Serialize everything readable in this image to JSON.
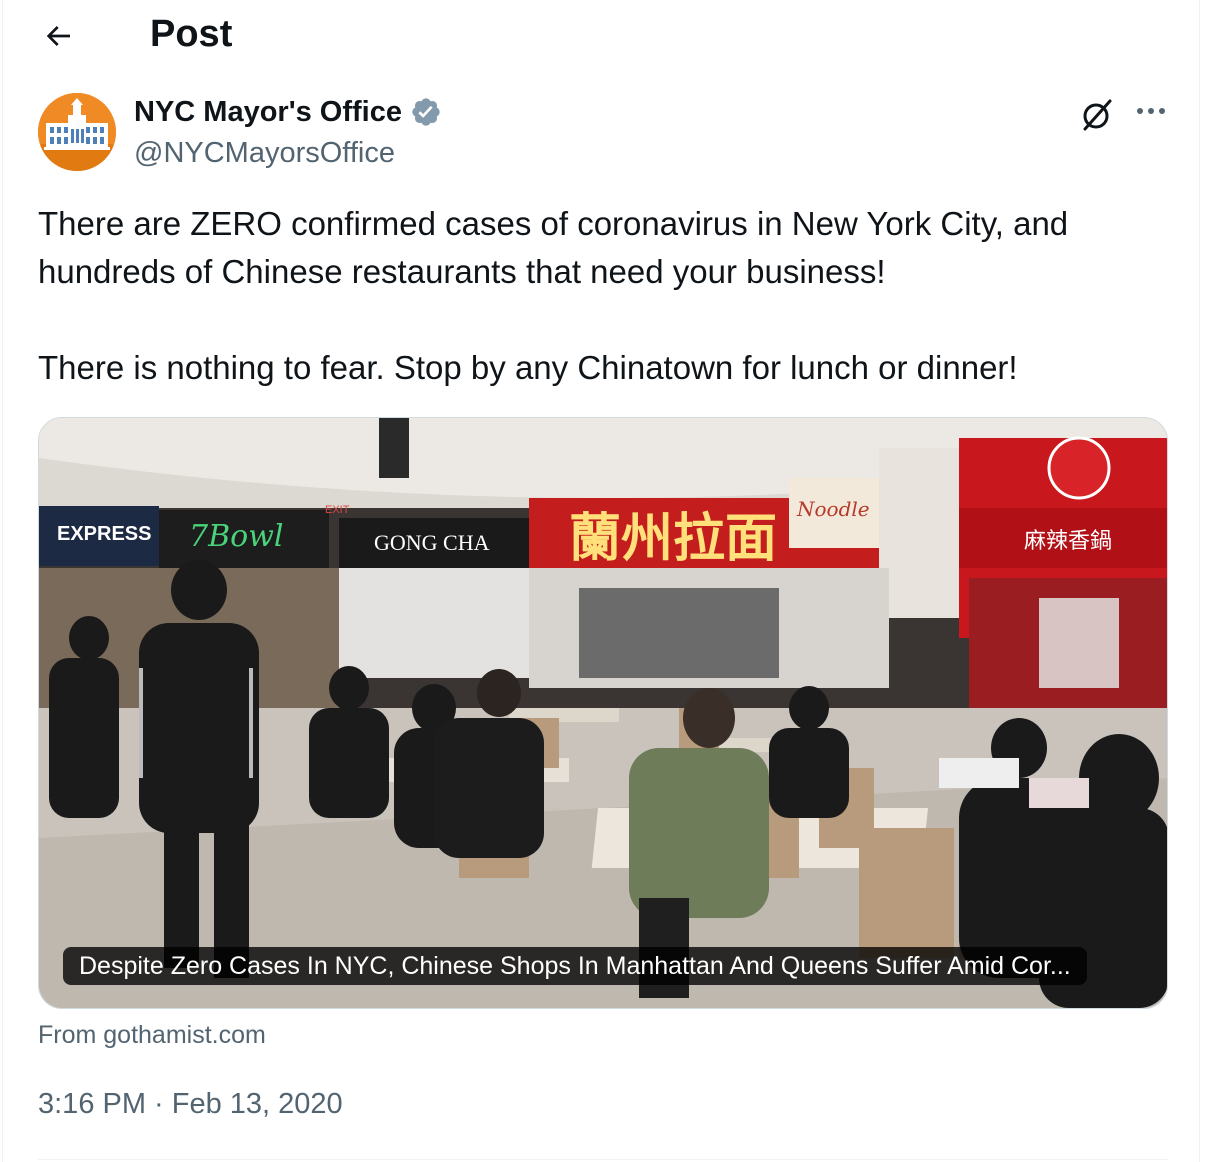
{
  "header": {
    "title": "Post",
    "back_icon": "arrow-left-icon"
  },
  "author": {
    "name": "NYC Mayor's Office",
    "handle": "@NYCMayorsOffice",
    "verified": true,
    "verified_color": "#829aab",
    "avatar_color": "#f08a24"
  },
  "actions": {
    "grok_icon": "grok-icon",
    "more_icon": "more-horizontal-icon"
  },
  "tweet": {
    "line1": "There are ZERO confirmed cases of coronavirus in New York City, and hundreds of Chinese restaurants that need your business!",
    "line2": "There is nothing to fear. Stop by any Chinatown for lunch or dinner!"
  },
  "card": {
    "caption": "Despite Zero Cases In NYC, Chinese Shops In Manhattan And Queens Suffer Amid Cor...",
    "source": "From gothamist.com",
    "signs": {
      "express": "EXPRESS",
      "seven_bowl": "7Bowl",
      "gong_cha": "GONG CHA",
      "noodle": "Noodle",
      "lanzhou": "蘭州拉面",
      "malatang": "麻辣香鍋",
      "exit": "EXIT"
    }
  },
  "timestamp": "3:16 PM · Feb 13, 2020",
  "colors": {
    "text": "#0f1419",
    "secondary": "#536471",
    "border": "#cfd9de"
  }
}
